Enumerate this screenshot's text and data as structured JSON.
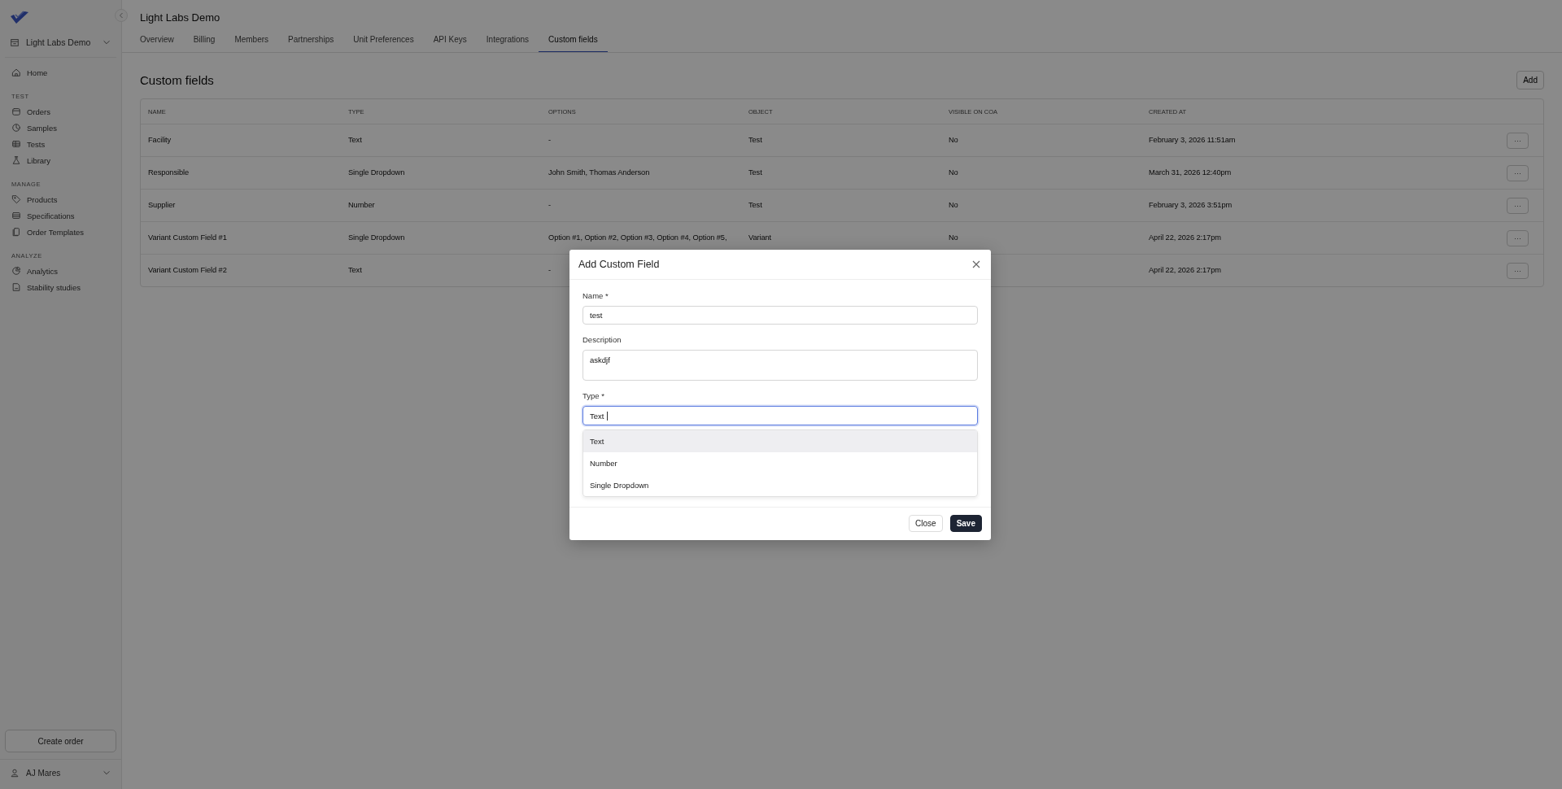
{
  "sidebar": {
    "workspace": "Light Labs Demo",
    "sections": [
      {
        "items": [
          {
            "label": "Home"
          }
        ]
      },
      {
        "title": "TEST",
        "items": [
          {
            "label": "Orders"
          },
          {
            "label": "Samples"
          },
          {
            "label": "Tests"
          },
          {
            "label": "Library"
          }
        ]
      },
      {
        "title": "MANAGE",
        "items": [
          {
            "label": "Products"
          },
          {
            "label": "Specifications"
          },
          {
            "label": "Order Templates"
          }
        ]
      },
      {
        "title": "ANALYZE",
        "items": [
          {
            "label": "Analytics"
          },
          {
            "label": "Stability studies"
          }
        ]
      }
    ],
    "create_button": "Create order",
    "user": "AJ Mares"
  },
  "header": {
    "title": "Light Labs Demo",
    "tabs": [
      {
        "label": "Overview",
        "selected": false
      },
      {
        "label": "Billing",
        "selected": false
      },
      {
        "label": "Members",
        "selected": false
      },
      {
        "label": "Partnerships",
        "selected": false
      },
      {
        "label": "Unit Preferences",
        "selected": false
      },
      {
        "label": "API Keys",
        "selected": false
      },
      {
        "label": "Integrations",
        "selected": false
      },
      {
        "label": "Custom fields",
        "selected": true
      }
    ]
  },
  "page": {
    "title": "Custom fields",
    "add_button": "Add"
  },
  "table": {
    "columns": [
      "NAME",
      "TYPE",
      "OPTIONS",
      "OBJECT",
      "VISIBLE ON COA",
      "CREATED AT"
    ],
    "rows": [
      {
        "cells": [
          "Facility",
          "Text",
          "-",
          "Test",
          "No",
          "February 3, 2026 11:51am"
        ],
        "menu": "···"
      },
      {
        "cells": [
          "Responsible",
          "Single Dropdown",
          "John Smith, Thomas Anderson",
          "Test",
          "No",
          "March 31, 2026 12:40pm"
        ],
        "menu": "···"
      },
      {
        "cells": [
          "Supplier",
          "Number",
          "-",
          "Test",
          "No",
          "February 3, 2026 3:51pm"
        ],
        "menu": "···"
      },
      {
        "cells": [
          "Variant Custom Field #1",
          "Single Dropdown",
          "Option #1, Option #2, Option #3, Option #4, Option #5,",
          "Variant",
          "No",
          "April 22, 2026 2:17pm"
        ],
        "menu": "···"
      },
      {
        "cells": [
          "Variant Custom Field #2",
          "Text",
          "-",
          null,
          null,
          "April 22, 2026 2:17pm"
        ],
        "menu": "···"
      }
    ]
  },
  "dialog": {
    "title": "Add Custom Field",
    "name": {
      "label": "Name *",
      "value": "test"
    },
    "description": {
      "label": "Description",
      "value": "askdjf"
    },
    "type": {
      "label": "Type *",
      "value": "Text",
      "focused": true
    },
    "options": [
      {
        "label": "Text",
        "selected": true
      },
      {
        "label": "Number",
        "selected": false
      },
      {
        "label": "Single Dropdown",
        "selected": false
      }
    ],
    "buttons": {
      "close": "Close",
      "save": "Save"
    }
  }
}
